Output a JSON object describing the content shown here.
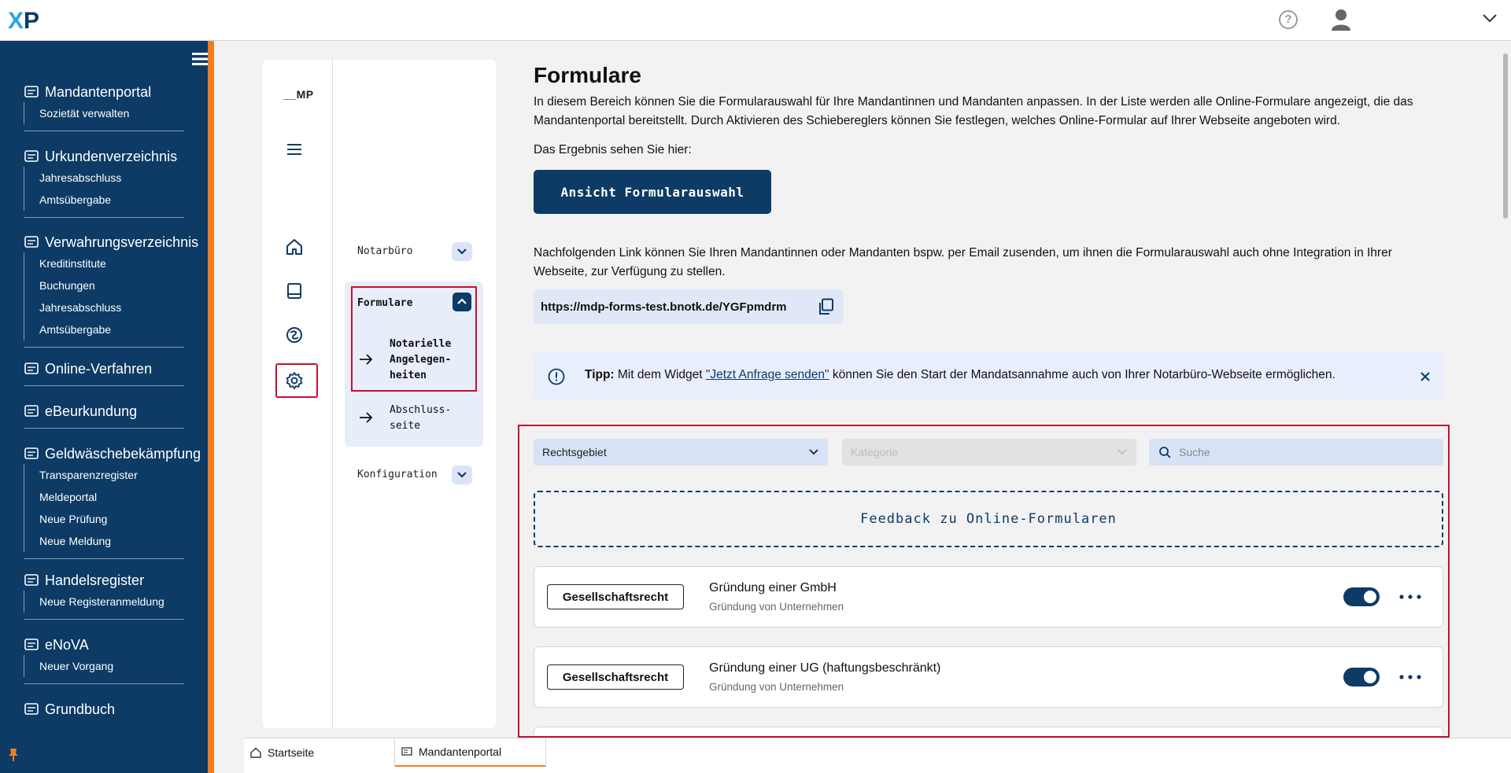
{
  "topbar": {
    "logo_text": "XP",
    "help_glyph": "?"
  },
  "leftnav": {
    "sections": [
      {
        "title": "Mandantenportal",
        "icon": "portal-icon",
        "items": [
          "Sozietät verwalten"
        ]
      },
      {
        "title": "Urkundenverzeichnis",
        "icon": "document-icon",
        "items": [
          "Jahresabschluss",
          "Amtsübergabe"
        ]
      },
      {
        "title": "Verwahrungsverzeichnis",
        "icon": "bank-icon",
        "items": [
          "Kreditinstitute",
          "Buchungen",
          "Jahresabschluss",
          "Amtsübergabe"
        ]
      },
      {
        "title": "Online-Verfahren",
        "icon": "video-icon",
        "items": []
      },
      {
        "title": "eBeurkundung",
        "icon": "signature-icon",
        "items": []
      },
      {
        "title": "Geldwäschebekämpfung",
        "icon": "money-icon",
        "items": [
          "Transparenzregister",
          "Meldeportal",
          "Neue Prüfung",
          "Neue Meldung"
        ]
      },
      {
        "title": "Handelsregister",
        "icon": "register-icon",
        "items": [
          "Neue Registeranmeldung"
        ]
      },
      {
        "title": "eNoVA",
        "icon": "enova-icon",
        "items": [
          "Neuer Vorgang"
        ]
      },
      {
        "title": "Grundbuch",
        "icon": "grundbuch-icon",
        "items": []
      }
    ]
  },
  "subnav": {
    "logo": "__MP",
    "notarbuero": "Notarbüro",
    "formulare": "Formulare",
    "notarielle_lines": [
      "Notarielle",
      "Angelegen-",
      "heiten"
    ],
    "abschluss_lines": [
      "Abschluss-",
      "seite"
    ],
    "konfiguration": "Konfiguration"
  },
  "main": {
    "title": "Formulare",
    "intro": "In diesem Bereich können Sie die Formularauswahl für Ihre Mandantinnen und Mandanten anpassen. In der Liste werden alle Online-Formulare angezeigt, die das Mandantenportal bereitstellt. Durch Aktivieren des Schiebereglers können Sie festlegen, welches Online-Formular auf Ihrer Webseite angeboten wird.",
    "result_label": "Das Ergebnis sehen Sie hier:",
    "view_button": "Ansicht Formularauswahl",
    "link_text": "Nachfolgenden Link können Sie Ihren Mandantinnen oder Mandanten bspw. per Email zusenden, um ihnen die Formularauswahl auch ohne Integration in Ihrer Webseite, zur Verfügung zu stellen.",
    "url": "https://mdp-forms-test.bnotk.de/YGFpmdrm",
    "tip_label": "Tipp:",
    "tip_pre": " Mit dem Widget ",
    "tip_link": "\"Jetzt Anfrage senden\"",
    "tip_post": " können Sie den Start der Mandatsannahme auch von Ihrer Notarbüro-Webseite ermöglichen."
  },
  "filters": {
    "rechtsgebiet": "Rechtsgebiet",
    "kategorie": "Kategorie",
    "search_placeholder": "Suche"
  },
  "feedback_label": "Feedback zu Online-Formularen",
  "forms": [
    {
      "badge": "Gesellschaftsrecht",
      "title": "Gründung einer GmbH",
      "subtitle": "Gründung von Unternehmen",
      "enabled": true
    },
    {
      "badge": "Gesellschaftsrecht",
      "title": "Gründung einer UG (haftungsbeschränkt)",
      "subtitle": "Gründung von Unternehmen",
      "enabled": true
    }
  ],
  "tabs": [
    {
      "label": "Startseite",
      "icon": "home-icon"
    },
    {
      "label": "Mandantenportal",
      "icon": "portal-icon"
    }
  ],
  "colors": {
    "brand": "#0d3b66",
    "accent": "#f47c20",
    "highlight": "#c8102e"
  }
}
